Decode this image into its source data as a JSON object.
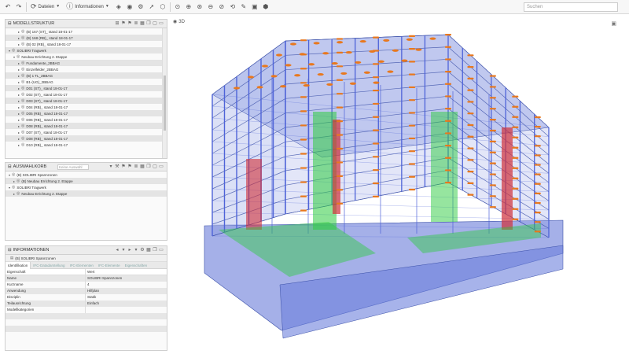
{
  "toolbar": {
    "datei_label": "Dateien",
    "info_label": "Informationen",
    "search_placeholder": "Suchen"
  },
  "model_tree": {
    "title": "MODELLSTRUKTUR",
    "rows": [
      {
        "indent": 2,
        "label": "(B) 167 (ST)_ stand 18-01-17"
      },
      {
        "indent": 2,
        "label": "(B) 168 (RB)_ stand 18-01-17"
      },
      {
        "indent": 2,
        "label": "(B) 02 (RB)_ stand 18-01-17"
      },
      {
        "indent": 0,
        "label": "SOLIBRI Tragwerk",
        "expanded": true
      },
      {
        "indent": 1,
        "label": "Neubau Errichtung 2. Etappe",
        "expanded": true
      },
      {
        "indent": 2,
        "label": "Fundamente_2BBAG"
      },
      {
        "indent": 2,
        "label": "Einzelfelder_2BBAG"
      },
      {
        "indent": 2,
        "label": "(B) 1 TL_2BBAG"
      },
      {
        "indent": 2,
        "label": "B1-(UG)_2BBAG"
      },
      {
        "indent": 2,
        "label": "D01 (ST)_ stand 18-01-17"
      },
      {
        "indent": 2,
        "label": "D02 (ST)_ stand 18-01-17"
      },
      {
        "indent": 2,
        "label": "D03 (ST)_ stand 18-01-17"
      },
      {
        "indent": 2,
        "label": "D04 (RB)_ stand 18-01-17"
      },
      {
        "indent": 2,
        "label": "D05 (RB)_ stand 18-01-17"
      },
      {
        "indent": 2,
        "label": "D06 (RB)_ stand 18-01-17"
      },
      {
        "indent": 2,
        "label": "D08 (RB)_ stand 18-01-17"
      },
      {
        "indent": 2,
        "label": "D07 (ST)_ stand 18-01-17"
      },
      {
        "indent": 2,
        "label": "D08 (RB)_ stand 18-01-17"
      },
      {
        "indent": 2,
        "label": "D10 (RB)_ stand 18-01-17"
      }
    ]
  },
  "selection_panel": {
    "title": "AUSWAHLKORB",
    "filter_placeholder": "Keine Auswahl",
    "rows": [
      {
        "indent": 0,
        "label": "(B) SOLIBRI Spannzonen",
        "expanded": true
      },
      {
        "indent": 1,
        "label": "(B) Neubau Errichtung 2. Etappe"
      },
      {
        "indent": 0,
        "label": "SOLIBRI Tragwerk",
        "expanded": true
      },
      {
        "indent": 1,
        "label": "Neubau Errichtung 2. Etappe"
      }
    ]
  },
  "info_panel": {
    "title": "INFORMATIONEN",
    "object_title": "(B) SOLIBRI Spannzonen",
    "tabs": [
      "Identifikation",
      "IFC-Datadarstellung",
      "IFC-Elementen",
      "IFC-Elemente",
      "Eigenschaften"
    ],
    "col_property": "Eigenschaft",
    "col_value": "Wert",
    "rows": [
      {
        "key": "Name",
        "value": "SOLIBRI Spannzonen"
      },
      {
        "key": "Kurzname",
        "value": "4"
      },
      {
        "key": "Anwendung",
        "value": "Hilfplan"
      },
      {
        "key": "Disziplin",
        "value": "Statik"
      },
      {
        "key": "Teilausrichtung",
        "value": "Einfach"
      },
      {
        "key": "Modellkategorien",
        "value": ""
      }
    ]
  },
  "viewport": {
    "label": "3D",
    "colors": {
      "floor_fill": "#7f8fe0",
      "column": "#4e63d8",
      "beam_orange": "#e8781e",
      "highlight_green": "#2ecc40",
      "highlight_red": "#d0303a",
      "edge": "#3a4fa8"
    }
  }
}
